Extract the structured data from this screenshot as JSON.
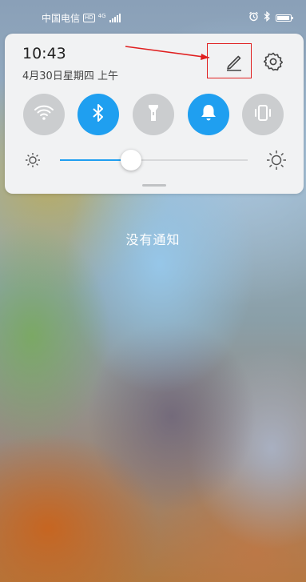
{
  "status_bar": {
    "carrier": "中国电信",
    "hd_badge": "HD",
    "network": "4G",
    "icons": [
      "alarm-icon",
      "bluetooth-icon",
      "battery-icon"
    ]
  },
  "panel": {
    "time": "10:43",
    "date": "4月30日星期四 上午",
    "icons": [
      "edit-pencil-icon",
      "settings-gear-icon"
    ],
    "toggles": [
      {
        "name": "wifi",
        "on": false
      },
      {
        "name": "bluetooth",
        "on": true
      },
      {
        "name": "flashlight",
        "on": false
      },
      {
        "name": "sound-bell",
        "on": true
      },
      {
        "name": "vibrate",
        "on": false
      }
    ],
    "brightness_level": 0.38,
    "accent_color": "#1f9ff0",
    "annotation_color": "#e02020"
  },
  "notifications": {
    "empty_text": "没有通知"
  }
}
